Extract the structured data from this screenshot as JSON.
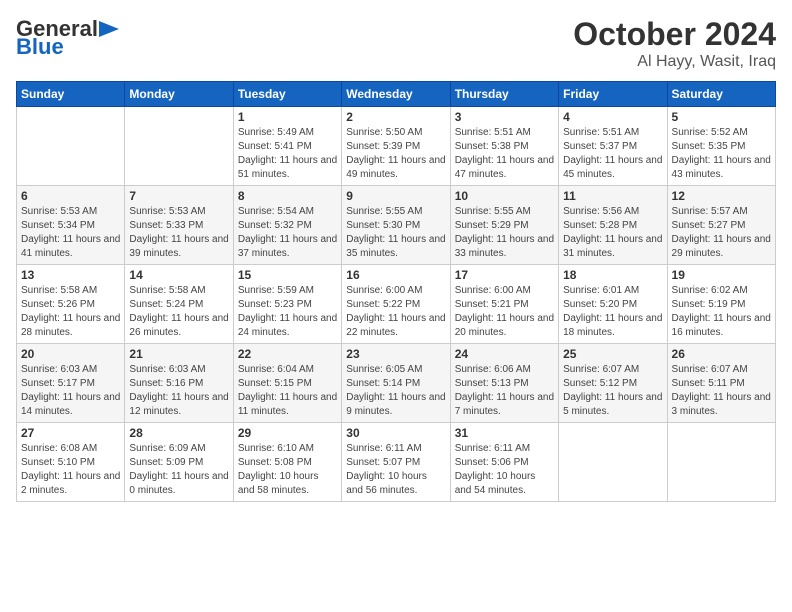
{
  "header": {
    "logo_general": "General",
    "logo_blue": "Blue",
    "month_title": "October 2024",
    "location": "Al Hayy, Wasit, Iraq"
  },
  "calendar": {
    "days_of_week": [
      "Sunday",
      "Monday",
      "Tuesday",
      "Wednesday",
      "Thursday",
      "Friday",
      "Saturday"
    ],
    "weeks": [
      [
        {
          "day": "",
          "info": ""
        },
        {
          "day": "",
          "info": ""
        },
        {
          "day": "1",
          "info": "Sunrise: 5:49 AM\nSunset: 5:41 PM\nDaylight: 11 hours and 51 minutes."
        },
        {
          "day": "2",
          "info": "Sunrise: 5:50 AM\nSunset: 5:39 PM\nDaylight: 11 hours and 49 minutes."
        },
        {
          "day": "3",
          "info": "Sunrise: 5:51 AM\nSunset: 5:38 PM\nDaylight: 11 hours and 47 minutes."
        },
        {
          "day": "4",
          "info": "Sunrise: 5:51 AM\nSunset: 5:37 PM\nDaylight: 11 hours and 45 minutes."
        },
        {
          "day": "5",
          "info": "Sunrise: 5:52 AM\nSunset: 5:35 PM\nDaylight: 11 hours and 43 minutes."
        }
      ],
      [
        {
          "day": "6",
          "info": "Sunrise: 5:53 AM\nSunset: 5:34 PM\nDaylight: 11 hours and 41 minutes."
        },
        {
          "day": "7",
          "info": "Sunrise: 5:53 AM\nSunset: 5:33 PM\nDaylight: 11 hours and 39 minutes."
        },
        {
          "day": "8",
          "info": "Sunrise: 5:54 AM\nSunset: 5:32 PM\nDaylight: 11 hours and 37 minutes."
        },
        {
          "day": "9",
          "info": "Sunrise: 5:55 AM\nSunset: 5:30 PM\nDaylight: 11 hours and 35 minutes."
        },
        {
          "day": "10",
          "info": "Sunrise: 5:55 AM\nSunset: 5:29 PM\nDaylight: 11 hours and 33 minutes."
        },
        {
          "day": "11",
          "info": "Sunrise: 5:56 AM\nSunset: 5:28 PM\nDaylight: 11 hours and 31 minutes."
        },
        {
          "day": "12",
          "info": "Sunrise: 5:57 AM\nSunset: 5:27 PM\nDaylight: 11 hours and 29 minutes."
        }
      ],
      [
        {
          "day": "13",
          "info": "Sunrise: 5:58 AM\nSunset: 5:26 PM\nDaylight: 11 hours and 28 minutes."
        },
        {
          "day": "14",
          "info": "Sunrise: 5:58 AM\nSunset: 5:24 PM\nDaylight: 11 hours and 26 minutes."
        },
        {
          "day": "15",
          "info": "Sunrise: 5:59 AM\nSunset: 5:23 PM\nDaylight: 11 hours and 24 minutes."
        },
        {
          "day": "16",
          "info": "Sunrise: 6:00 AM\nSunset: 5:22 PM\nDaylight: 11 hours and 22 minutes."
        },
        {
          "day": "17",
          "info": "Sunrise: 6:00 AM\nSunset: 5:21 PM\nDaylight: 11 hours and 20 minutes."
        },
        {
          "day": "18",
          "info": "Sunrise: 6:01 AM\nSunset: 5:20 PM\nDaylight: 11 hours and 18 minutes."
        },
        {
          "day": "19",
          "info": "Sunrise: 6:02 AM\nSunset: 5:19 PM\nDaylight: 11 hours and 16 minutes."
        }
      ],
      [
        {
          "day": "20",
          "info": "Sunrise: 6:03 AM\nSunset: 5:17 PM\nDaylight: 11 hours and 14 minutes."
        },
        {
          "day": "21",
          "info": "Sunrise: 6:03 AM\nSunset: 5:16 PM\nDaylight: 11 hours and 12 minutes."
        },
        {
          "day": "22",
          "info": "Sunrise: 6:04 AM\nSunset: 5:15 PM\nDaylight: 11 hours and 11 minutes."
        },
        {
          "day": "23",
          "info": "Sunrise: 6:05 AM\nSunset: 5:14 PM\nDaylight: 11 hours and 9 minutes."
        },
        {
          "day": "24",
          "info": "Sunrise: 6:06 AM\nSunset: 5:13 PM\nDaylight: 11 hours and 7 minutes."
        },
        {
          "day": "25",
          "info": "Sunrise: 6:07 AM\nSunset: 5:12 PM\nDaylight: 11 hours and 5 minutes."
        },
        {
          "day": "26",
          "info": "Sunrise: 6:07 AM\nSunset: 5:11 PM\nDaylight: 11 hours and 3 minutes."
        }
      ],
      [
        {
          "day": "27",
          "info": "Sunrise: 6:08 AM\nSunset: 5:10 PM\nDaylight: 11 hours and 2 minutes."
        },
        {
          "day": "28",
          "info": "Sunrise: 6:09 AM\nSunset: 5:09 PM\nDaylight: 11 hours and 0 minutes."
        },
        {
          "day": "29",
          "info": "Sunrise: 6:10 AM\nSunset: 5:08 PM\nDaylight: 10 hours and 58 minutes."
        },
        {
          "day": "30",
          "info": "Sunrise: 6:11 AM\nSunset: 5:07 PM\nDaylight: 10 hours and 56 minutes."
        },
        {
          "day": "31",
          "info": "Sunrise: 6:11 AM\nSunset: 5:06 PM\nDaylight: 10 hours and 54 minutes."
        },
        {
          "day": "",
          "info": ""
        },
        {
          "day": "",
          "info": ""
        }
      ]
    ]
  }
}
